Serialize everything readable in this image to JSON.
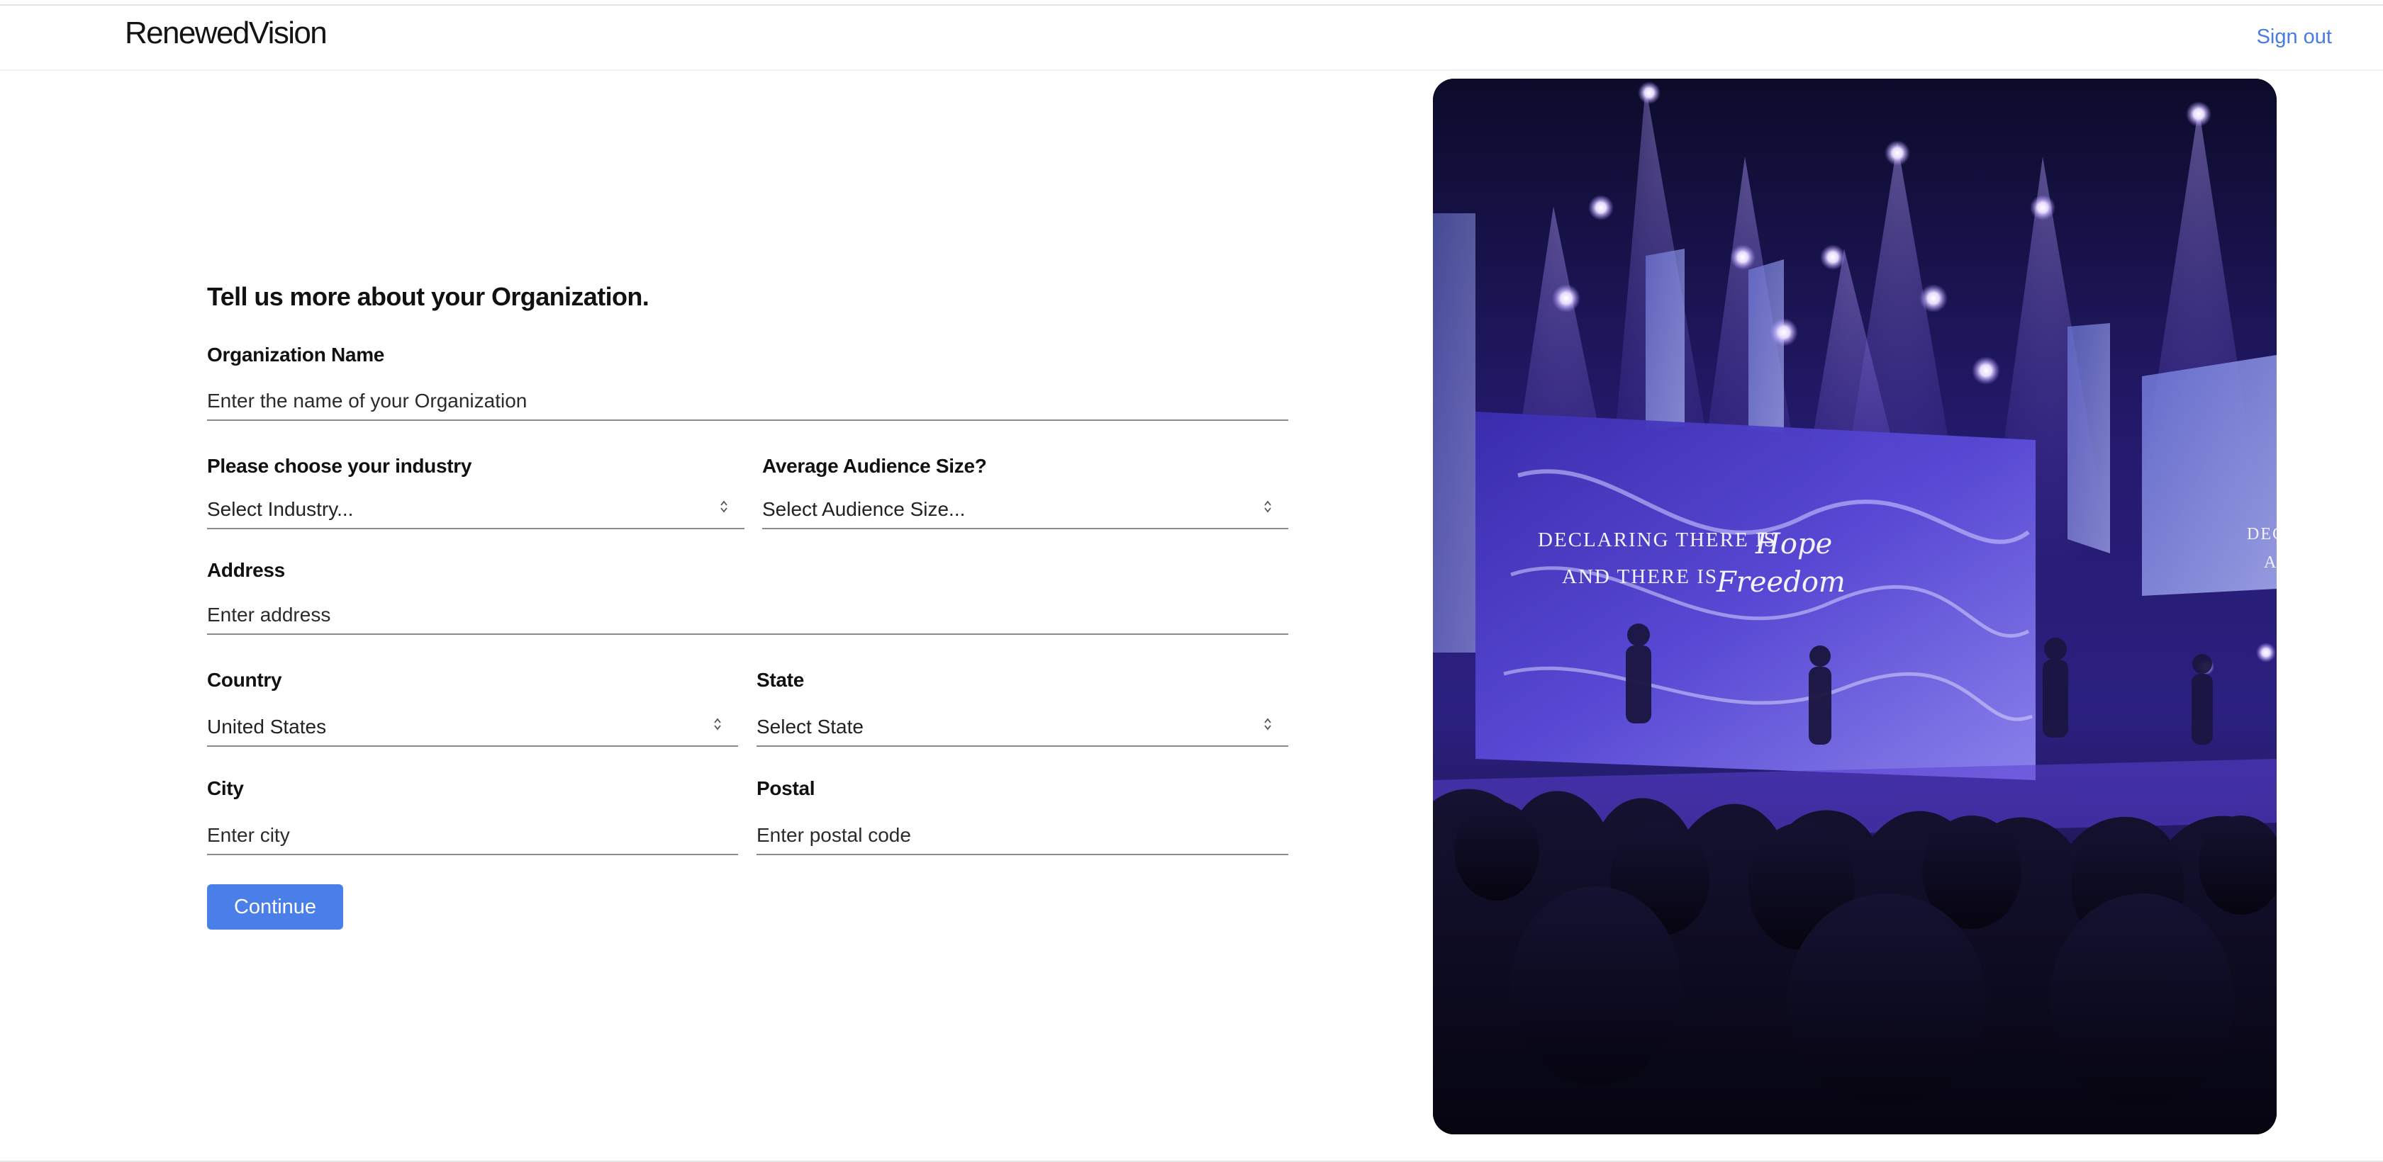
{
  "header": {
    "logo": "RenewedVision",
    "sign_out": "Sign out"
  },
  "form": {
    "title": "Tell us more about your Organization.",
    "org_name": {
      "label": "Organization Name",
      "placeholder": "Enter the name of your Organization"
    },
    "industry": {
      "label": "Please choose your industry",
      "selected": "Select Industry..."
    },
    "audience": {
      "label": "Average Audience Size?",
      "selected": "Select Audience Size..."
    },
    "address": {
      "label": "Address",
      "placeholder": "Enter address"
    },
    "country": {
      "label": "Country",
      "selected": "United States"
    },
    "state": {
      "label": "State",
      "selected": "Select State"
    },
    "city": {
      "label": "City",
      "placeholder": "Enter city"
    },
    "postal": {
      "label": "Postal",
      "placeholder": "Enter postal code"
    },
    "continue_label": "Continue"
  },
  "hero": {
    "screen_text_line1": "DECLARING THERE IS",
    "screen_text_word1": "Hope",
    "screen_text_line2": "AND THERE IS",
    "screen_text_word2": "Freedom",
    "screen_text_right_line1": "DEC",
    "screen_text_right_line2": "A",
    "colors": {
      "stage_purple": "#5a3fd1",
      "dark_crowd": "#0a0918",
      "light_glow": "#b9a6ff"
    }
  },
  "colors": {
    "accent": "#4a7ee8",
    "link": "#4a7be6",
    "underline": "#8a8a8a"
  }
}
